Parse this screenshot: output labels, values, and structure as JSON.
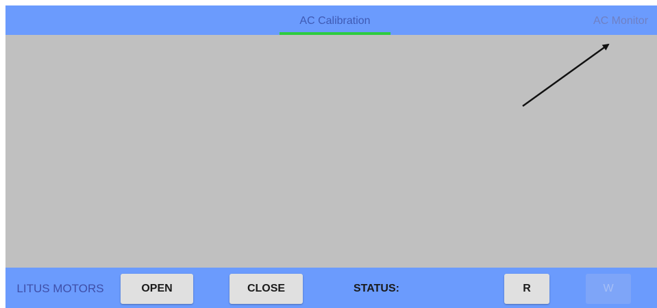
{
  "tabs": {
    "items": [
      {
        "label": "AC Calibration",
        "active": true
      },
      {
        "label": "AC Monitor",
        "active": false
      }
    ],
    "indicator_color": "#2ecc3e"
  },
  "bottom_bar": {
    "brand": "LITUS MOTORS",
    "open_label": "OPEN",
    "close_label": "CLOSE",
    "status_label": "STATUS:",
    "read_label": "R",
    "write_label": "W"
  },
  "colors": {
    "bar": "#6b9bfd",
    "content": "#c0c0c0",
    "tab_text": "#3f5ab4"
  }
}
